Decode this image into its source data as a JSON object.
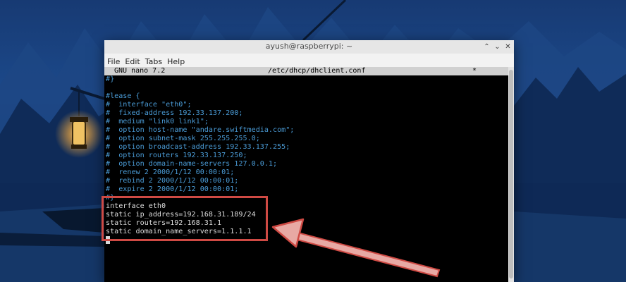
{
  "window": {
    "title": "ayush@raspberrypi: ~"
  },
  "menubar": {
    "items": [
      "File",
      "Edit",
      "Tabs",
      "Help"
    ]
  },
  "nano": {
    "version": "GNU nano 7.2",
    "filename": "/etc/dhcp/dhclient.conf",
    "modified_flag": "*"
  },
  "editor": {
    "lines": [
      "#}",
      "",
      "#lease {",
      "#  interface \"eth0\";",
      "#  fixed-address 192.33.137.200;",
      "#  medium \"link0 link1\";",
      "#  option host-name \"andare.swiftmedia.com\";",
      "#  option subnet-mask 255.255.255.0;",
      "#  option broadcast-address 192.33.137.255;",
      "#  option routers 192.33.137.250;",
      "#  option domain-name-servers 127.0.0.1;",
      "#  renew 2 2000/1/12 00:00:01;",
      "#  rebind 2 2000/1/12 00:00:01;",
      "#  expire 2 2000/1/12 00:00:01;",
      "#}",
      "interface eth0",
      "static ip_address=192.168.31.189/24",
      "static routers=192.168.31.1",
      "static domain_name_servers=1.1.1.1"
    ]
  },
  "colors": {
    "comment_text": "#4a9bd6",
    "plain_text": "#dcdcdc",
    "annotation": "#cf4a44"
  },
  "icons": {
    "collapse": "chevron-up-icon",
    "minimize": "chevron-down-icon",
    "close": "close-icon"
  }
}
